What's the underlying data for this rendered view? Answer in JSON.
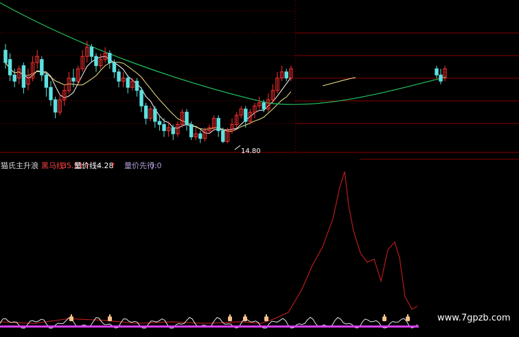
{
  "colors": {
    "background": "#000000",
    "grid": "#8b0000",
    "candle_up": "#ff3030",
    "candle_down": "#5fe0e0",
    "ma_short": "#ffffff",
    "ma_mid": "#f0e68c",
    "ma_long": "#22c55e",
    "indicator_red": "#b91c1c",
    "indicator_white": "#e5e7eb",
    "indicator_magenta": "#e040fb",
    "marker": "#f5c28a"
  },
  "price_panel": {
    "low_label": "14.80"
  },
  "legend": {
    "indicator_name": "猫氏主升浪",
    "item1_label": "黑马线:",
    "item1_value": "35.51",
    "item1_arrow": "↑",
    "item2_label": "量价线:",
    "item2_value": "4.28",
    "item2_arrow": "↑",
    "item3_label": "量价先行:",
    "item3_value": "0.0"
  },
  "watermark": "www.7gpzb.com",
  "chart_data": {
    "type": "line",
    "candles": [
      {
        "o": 17.8,
        "c": 17.4,
        "h": 18.0,
        "l": 17.2
      },
      {
        "o": 17.5,
        "c": 17.0,
        "h": 17.7,
        "l": 16.8
      },
      {
        "o": 17.0,
        "c": 16.8,
        "h": 17.2,
        "l": 16.6
      },
      {
        "o": 16.9,
        "c": 17.2,
        "h": 17.3,
        "l": 16.7
      },
      {
        "o": 17.3,
        "c": 16.6,
        "h": 17.4,
        "l": 16.4
      },
      {
        "o": 16.7,
        "c": 16.9,
        "h": 17.2,
        "l": 16.5
      },
      {
        "o": 16.9,
        "c": 17.4,
        "h": 17.6,
        "l": 16.8
      },
      {
        "o": 17.4,
        "c": 17.6,
        "h": 17.8,
        "l": 17.2
      },
      {
        "o": 17.5,
        "c": 17.0,
        "h": 17.6,
        "l": 16.8
      },
      {
        "o": 17.0,
        "c": 16.6,
        "h": 17.1,
        "l": 16.3
      },
      {
        "o": 16.6,
        "c": 16.2,
        "h": 16.8,
        "l": 16.0
      },
      {
        "o": 16.2,
        "c": 15.8,
        "h": 16.3,
        "l": 15.6
      },
      {
        "o": 15.8,
        "c": 16.2,
        "h": 16.4,
        "l": 15.7
      },
      {
        "o": 16.2,
        "c": 16.5,
        "h": 16.7,
        "l": 16.0
      },
      {
        "o": 16.5,
        "c": 16.9,
        "h": 17.1,
        "l": 16.4
      },
      {
        "o": 16.9,
        "c": 16.8,
        "h": 17.2,
        "l": 16.6
      },
      {
        "o": 16.8,
        "c": 17.2,
        "h": 17.3,
        "l": 16.7
      },
      {
        "o": 17.2,
        "c": 17.6,
        "h": 17.8,
        "l": 17.1
      },
      {
        "o": 17.6,
        "c": 17.9,
        "h": 18.1,
        "l": 17.4
      },
      {
        "o": 17.9,
        "c": 17.6,
        "h": 18.0,
        "l": 17.4
      },
      {
        "o": 17.6,
        "c": 17.3,
        "h": 17.7,
        "l": 17.1
      },
      {
        "o": 17.3,
        "c": 17.5,
        "h": 17.7,
        "l": 17.2
      },
      {
        "o": 17.5,
        "c": 17.7,
        "h": 17.9,
        "l": 17.4
      },
      {
        "o": 17.7,
        "c": 17.4,
        "h": 17.8,
        "l": 17.2
      },
      {
        "o": 17.4,
        "c": 17.1,
        "h": 17.5,
        "l": 16.9
      },
      {
        "o": 17.1,
        "c": 16.8,
        "h": 17.2,
        "l": 16.6
      },
      {
        "o": 16.8,
        "c": 16.9,
        "h": 17.1,
        "l": 16.6
      },
      {
        "o": 16.9,
        "c": 16.6,
        "h": 17.0,
        "l": 16.4
      },
      {
        "o": 16.6,
        "c": 16.8,
        "h": 16.9,
        "l": 16.5
      },
      {
        "o": 16.8,
        "c": 16.5,
        "h": 16.9,
        "l": 16.3
      },
      {
        "o": 16.5,
        "c": 16.0,
        "h": 16.6,
        "l": 15.8
      },
      {
        "o": 16.0,
        "c": 15.6,
        "h": 16.1,
        "l": 15.4
      },
      {
        "o": 15.6,
        "c": 15.9,
        "h": 16.0,
        "l": 15.5
      },
      {
        "o": 15.9,
        "c": 15.5,
        "h": 16.0,
        "l": 15.3
      },
      {
        "o": 15.5,
        "c": 15.4,
        "h": 15.7,
        "l": 15.2
      },
      {
        "o": 15.4,
        "c": 15.2,
        "h": 15.6,
        "l": 15.0
      },
      {
        "o": 15.2,
        "c": 15.3,
        "h": 15.5,
        "l": 15.0
      },
      {
        "o": 15.3,
        "c": 15.1,
        "h": 15.4,
        "l": 14.9
      },
      {
        "o": 15.1,
        "c": 15.4,
        "h": 15.5,
        "l": 15.0
      },
      {
        "o": 15.4,
        "c": 15.8,
        "h": 15.9,
        "l": 15.3
      },
      {
        "o": 15.8,
        "c": 15.4,
        "h": 15.9,
        "l": 15.2
      },
      {
        "o": 15.4,
        "c": 15.0,
        "h": 15.5,
        "l": 14.9
      },
      {
        "o": 15.0,
        "c": 15.1,
        "h": 15.3,
        "l": 14.9
      },
      {
        "o": 15.1,
        "c": 14.95,
        "h": 15.2,
        "l": 14.8
      },
      {
        "o": 14.95,
        "c": 15.2,
        "h": 15.3,
        "l": 14.85
      },
      {
        "o": 15.2,
        "c": 15.3,
        "h": 15.4,
        "l": 15.1
      },
      {
        "o": 15.3,
        "c": 15.6,
        "h": 15.7,
        "l": 15.2
      },
      {
        "o": 15.6,
        "c": 15.2,
        "h": 15.7,
        "l": 15.0
      },
      {
        "o": 15.2,
        "c": 14.85,
        "h": 15.3,
        "l": 14.8
      },
      {
        "o": 14.85,
        "c": 15.2,
        "h": 15.3,
        "l": 14.8
      },
      {
        "o": 15.2,
        "c": 15.4,
        "h": 15.6,
        "l": 15.1
      },
      {
        "o": 15.4,
        "c": 15.7,
        "h": 15.8,
        "l": 15.3
      },
      {
        "o": 15.7,
        "c": 15.9,
        "h": 16.0,
        "l": 15.6
      },
      {
        "o": 15.9,
        "c": 15.5,
        "h": 16.0,
        "l": 15.3
      },
      {
        "o": 15.5,
        "c": 15.8,
        "h": 15.9,
        "l": 15.4
      },
      {
        "o": 15.8,
        "c": 16.0,
        "h": 16.1,
        "l": 15.6
      },
      {
        "o": 16.0,
        "c": 16.1,
        "h": 16.3,
        "l": 15.9
      },
      {
        "o": 16.1,
        "c": 15.9,
        "h": 16.2,
        "l": 15.8
      },
      {
        "o": 15.9,
        "c": 16.2,
        "h": 16.4,
        "l": 15.8
      },
      {
        "o": 16.2,
        "c": 16.5,
        "h": 16.7,
        "l": 16.1
      },
      {
        "o": 16.5,
        "c": 16.9,
        "h": 17.1,
        "l": 16.4
      },
      {
        "o": 16.9,
        "c": 17.1,
        "h": 17.3,
        "l": 16.8
      },
      {
        "o": 17.1,
        "c": 16.9,
        "h": 17.2,
        "l": 16.8
      },
      {
        "o": 16.9,
        "c": 17.2,
        "h": 17.3,
        "l": 16.8
      }
    ],
    "right_candles": [
      {
        "o": 17.2,
        "c": 17.0,
        "h": 17.3,
        "l": 16.9
      },
      {
        "o": 17.0,
        "c": 16.8,
        "h": 17.2,
        "l": 16.7
      },
      {
        "o": 16.9,
        "c": 17.2,
        "h": 17.3,
        "l": 16.8
      }
    ],
    "ylim": [
      14.5,
      19.2
    ],
    "indicator_ylim": [
      0,
      100
    ]
  }
}
